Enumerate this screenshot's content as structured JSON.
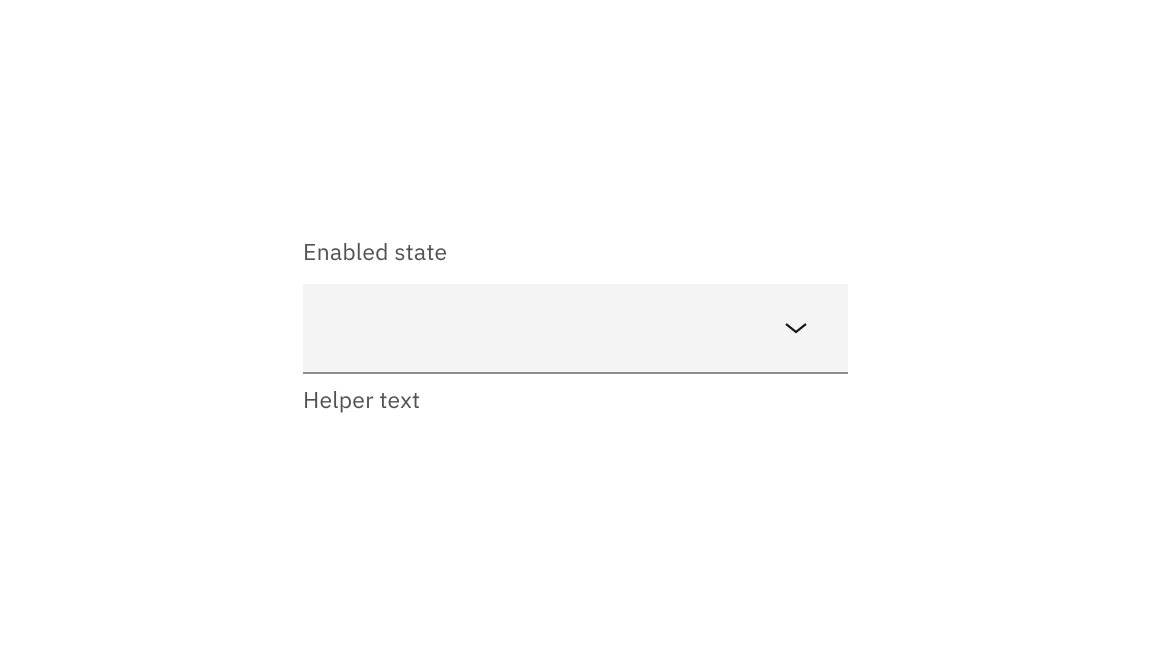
{
  "dropdown": {
    "label": "Enabled state",
    "value": "",
    "helper": "Helper text"
  }
}
